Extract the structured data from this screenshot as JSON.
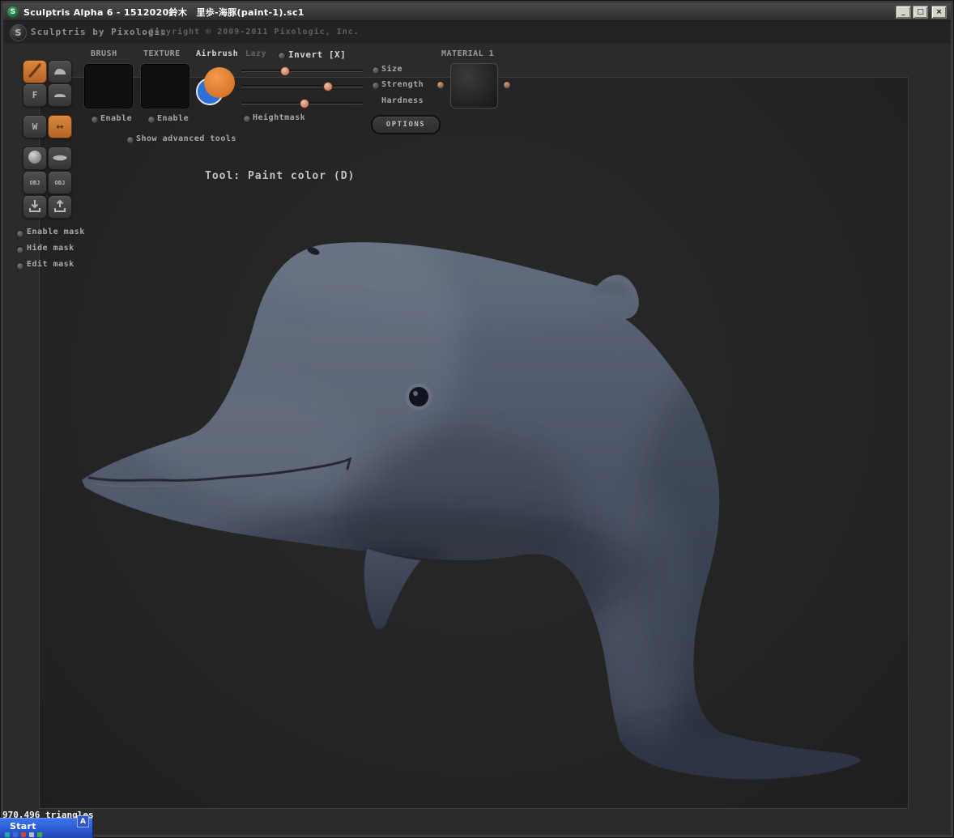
{
  "window": {
    "title": "Sculptris Alpha 6 - 1512020鈴木　里歩-海豚(paint-1).sc1",
    "logo_letter": "S",
    "controls": {
      "minimize": "_",
      "maximize": "□",
      "close": "×"
    }
  },
  "header": {
    "logo_letter": "S",
    "brand": "Sculptris by Pixologic",
    "copyright": "Copyright © 2009-2011 Pixologic, Inc."
  },
  "left_toolbar": {
    "fill_label": "F",
    "wireframe_label": "W",
    "symmetry_glyph": "↔",
    "obj_import_label": "OBJ",
    "obj_export_label": "OBJ"
  },
  "mask_options": {
    "enable": "Enable mask",
    "hide": "Hide mask",
    "edit": "Edit mask"
  },
  "toolbar": {
    "brush_label": "BRUSH",
    "brush_enable": "Enable",
    "texture_label": "TEXTURE",
    "texture_enable": "Enable",
    "airbrush_label": "Airbrush",
    "lazy_label": "Lazy",
    "invert_label": "Invert [X]",
    "sliders": [
      {
        "label": "Size",
        "value": 0.36
      },
      {
        "label": "Strength",
        "value": 0.71
      },
      {
        "label": "Hardness",
        "value": 0.52
      }
    ],
    "heightmask_label": "Heightmask",
    "options_label": "OPTIONS",
    "material_label": "MATERIAL 1",
    "show_advanced_label": "Show advanced tools"
  },
  "tool_status": "Tool: Paint color (D)",
  "statusbar": {
    "triangle_count": "970.496 triangles"
  },
  "taskbar": {
    "start_label": "Start",
    "ime_badge": "A"
  },
  "colors": {
    "accent-orange": "#b4632a",
    "slider-handle": "#c4795a",
    "taskbar-blue": "#2a5ad0",
    "dolphin-base": "#4c5567"
  }
}
